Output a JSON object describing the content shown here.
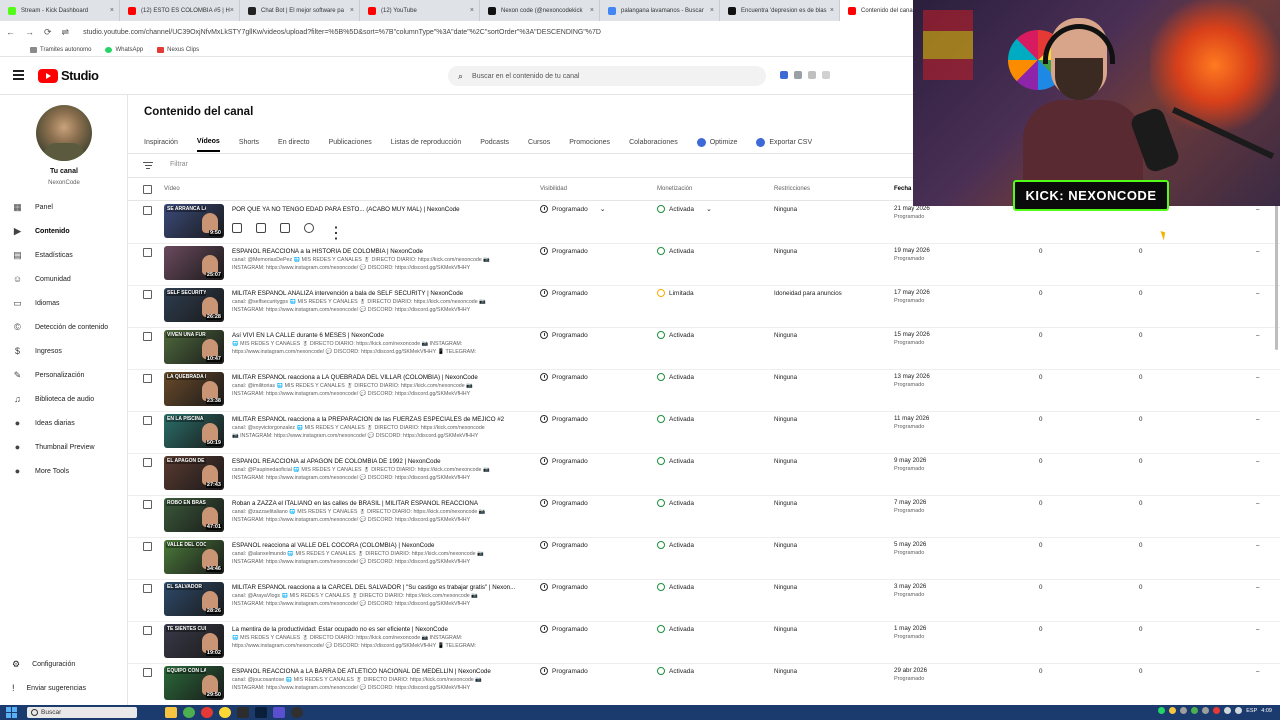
{
  "browser": {
    "tabs": [
      {
        "label": "Stream - Kick Dashboard",
        "color": "#53fc18",
        "active": false
      },
      {
        "label": "(12) ESTO ES COLOMBIA #5 | H",
        "color": "#ff0000",
        "active": false
      },
      {
        "label": "Chat Bot | El mejor software pa",
        "color": "#222222",
        "active": false
      },
      {
        "label": "(12) YouTube",
        "color": "#ff0000",
        "active": false
      },
      {
        "label": "Nexon code (@nexoncodekick",
        "color": "#111111",
        "active": false
      },
      {
        "label": "palangana lavamanos - Buscar",
        "color": "#4285f4",
        "active": false
      },
      {
        "label": "Encuentra 'depresion es de blas",
        "color": "#111111",
        "active": false
      },
      {
        "label": "Contenido del canal",
        "color": "#ff0000",
        "active": true
      }
    ],
    "url": "studio.youtube.com/channel/UC39OxjNfvMxLkSTY7gllKw/videos/upload?filter=%5B%5D&sort=%7B\"columnType\"%3A\"date\"%2C\"sortOrder\"%3A\"DESCENDING\"%7D",
    "bookmarks": [
      "Tramites autonomo",
      "WhatsApp",
      "Nexus Clips"
    ]
  },
  "header": {
    "logo_text": "Studio",
    "search_placeholder": "Buscar en el contenido de tu canal"
  },
  "sidebar": {
    "channel_name": "Tu canal",
    "channel_handle": "NexonCode",
    "items": [
      {
        "label": "Panel",
        "icon": "dashboard-icon",
        "active": false
      },
      {
        "label": "Contenido",
        "icon": "content-icon",
        "active": true
      },
      {
        "label": "Estadísticas",
        "icon": "analytics-icon",
        "active": false
      },
      {
        "label": "Comunidad",
        "icon": "community-icon",
        "active": false
      },
      {
        "label": "Idiomas",
        "icon": "subtitles-icon",
        "active": false
      },
      {
        "label": "Detección de contenido",
        "icon": "copyright-icon",
        "active": false
      },
      {
        "label": "Ingresos",
        "icon": "dollar-icon",
        "active": false
      },
      {
        "label": "Personalización",
        "icon": "wand-icon",
        "active": false
      },
      {
        "label": "Biblioteca de audio",
        "icon": "audio-library-icon",
        "active": false
      },
      {
        "label": "Ideas diarias",
        "icon": "ideas-icon",
        "active": false
      },
      {
        "label": "Thumbnail Preview",
        "icon": "thumbnail-preview-icon",
        "active": false
      },
      {
        "label": "More Tools",
        "icon": "tools-icon",
        "active": false
      }
    ],
    "footer": [
      {
        "label": "Configuración",
        "icon": "gear-icon"
      },
      {
        "label": "Enviar sugerencias",
        "icon": "feedback-icon"
      }
    ]
  },
  "main": {
    "title": "Contenido del canal",
    "tabs": [
      "Inspiración",
      "Vídeos",
      "Shorts",
      "En directo",
      "Publicaciones",
      "Listas de reproducción",
      "Podcasts",
      "Cursos",
      "Promociones",
      "Colaboraciones",
      "Optimize",
      "Exportar CSV"
    ],
    "active_tab": "Vídeos",
    "filter_placeholder": "Filtrar",
    "columns": {
      "video": "Vídeo",
      "visibility": "Visibilidad",
      "monetization": "Monetización",
      "restrictions": "Restricciones",
      "date": "Fecha"
    }
  },
  "videos": [
    {
      "title": "POR QUÉ YA NO TENGO EDAD PARA ESTO... (ACABÓ MUY MAL) | NexonCode",
      "desc1": "",
      "desc2": "",
      "duration": "9:50",
      "thumb_text": "SE ARRANCA LA NARIZ",
      "thumb_color": "#3b4a7a",
      "visibility": "Programado",
      "monetization": "Activada",
      "restrictions": "Ninguna",
      "date": "21 may 2026",
      "status": "Programado",
      "v1": "0",
      "v2": "0",
      "v3": "–"
    },
    {
      "title": "ESPAÑOL REACCIONA a la HISTORIA DE COLOMBIA | NexonCode",
      "desc1": "canal: @MemoriasDePez 🌐 MIS REDES Y CANALES 🎖 DIRECTO DIARIO: https://kick.com/nexoncode 📷",
      "desc2": "INSTAGRAM: https://www.instagram.com/nexoncode/ 💬 DISCORD: https://discord.gg/SKMekVfHHY",
      "duration": "25:07",
      "thumb_text": "",
      "thumb_color": "#6b4a5e",
      "visibility": "Programado",
      "monetization": "Activada",
      "restrictions": "Ninguna",
      "date": "19 may 2026",
      "status": "Programado",
      "v1": "0",
      "v2": "0",
      "v3": "–"
    },
    {
      "title": "MILITAR ESPAÑOL ANALIZA intervención a bala de SELF SECURITY | NexonCode",
      "desc1": "canal: @selfsecuritygps 🌐 MIS REDES Y CANALES 🎖 DIRECTO DIARIO: https://kick.com/nexoncode 📷",
      "desc2": "INSTAGRAM: https://www.instagram.com/nexoncode/ 💬 DISCORD: https://discord.gg/SKMekVfHHY",
      "duration": "26:28",
      "thumb_text": "SELF SECURITY COLOMBIA",
      "thumb_color": "#2e3d50",
      "visibility": "Programado",
      "monetization": "Limitada",
      "restrictions": "Idoneidad para anuncios",
      "date": "17 may 2026",
      "status": "Programado",
      "v1": "0",
      "v2": "0",
      "v3": "–"
    },
    {
      "title": "Así VIVÍ EN LA CALLE durante 6 MESES | NexonCode",
      "desc1": "🌐 MIS REDES Y CANALES 🎖 DIRECTO DIARIO: https://kick.com/nexoncode 📷 INSTAGRAM:",
      "desc2": "https://www.instagram.com/nexoncode/ 💬 DISCORD: https://discord.gg/SKMekVfHHY 📱 TELEGRAM:",
      "duration": "10:47",
      "thumb_text": "VIVEN UNA FURGONETA",
      "thumb_color": "#4e6a3c",
      "visibility": "Programado",
      "monetization": "Activada",
      "restrictions": "Ninguna",
      "date": "15 may 2026",
      "status": "Programado",
      "v1": "0",
      "v2": "0",
      "v3": "–"
    },
    {
      "title": "MILITAR ESPAÑOL reacciona a LA QUEBRADA DEL VILLAR (COLOMBIA) | NexonCode",
      "desc1": "canal: @imilitorias 🌐 MIS REDES Y CANALES 🎖 DIRECTO DIARIO: https://kick.com/nexoncode 📷",
      "desc2": "INSTAGRAM: https://www.instagram.com/nexoncode/ 💬 DISCORD: https://discord.gg/SKMekVfHHY",
      "duration": "23:38",
      "thumb_text": "LA QUEBRADA DEL VILLAR",
      "thumb_color": "#6a4a2a",
      "visibility": "Programado",
      "monetization": "Activada",
      "restrictions": "Ninguna",
      "date": "13 may 2026",
      "status": "Programado",
      "v1": "0",
      "v2": "0",
      "v3": "–"
    },
    {
      "title": "MILITAR ESPAÑOL reacciona a la PREPARACIÓN de las FUERZAS ESPECIALES de MÉJICO #2",
      "desc1": "canal: @soyvictorgonzalez 🌐 MIS REDES Y CANALES 🎖 DIRECTO DIARIO: https://kick.com/nexoncode",
      "desc2": "📷 INSTAGRAM: https://www.instagram.com/nexoncode/ 💬 DISCORD: https://discord.gg/SKMekVfHHY",
      "duration": "50:19",
      "thumb_text": "EN LA PISCINA",
      "thumb_color": "#2a6f6a",
      "visibility": "Programado",
      "monetization": "Activada",
      "restrictions": "Ninguna",
      "date": "11 may 2026",
      "status": "Programado",
      "v1": "0",
      "v2": "0",
      "v3": "–"
    },
    {
      "title": "ESPAÑOL REACCIONA al APAGON DE COLOMBIA DE 1992 | NexonCode",
      "desc1": "canal: @Paupinedaoficial 🌐 MIS REDES Y CANALES 🎖 DIRECTO DIARIO: https://kick.com/nexoncode 📷",
      "desc2": "INSTAGRAM: https://www.instagram.com/nexoncode/ 💬 DISCORD: https://discord.gg/SKMekVfHHY",
      "duration": "27:43",
      "thumb_text": "EL APAGÓN DE COLOMBIA",
      "thumb_color": "#5a3a30",
      "visibility": "Programado",
      "monetization": "Activada",
      "restrictions": "Ninguna",
      "date": "9 may 2026",
      "status": "Programado",
      "v1": "0",
      "v2": "0",
      "v3": "–"
    },
    {
      "title": "Roban a ZAZZA el ITALIANO en las calles de BRASIL | MILITAR ESPAÑOL REACCIONA",
      "desc1": "canal: @zazzaelitaliano 🌐 MIS REDES Y CANALES 🎖 DIRECTO DIARIO: https://kick.com/nexoncode 📷",
      "desc2": "INSTAGRAM: https://www.instagram.com/nexoncode/ 💬 DISCORD: https://discord.gg/SKMekVfHHY",
      "duration": "47:01",
      "thumb_text": "ROBO EN BRASIL",
      "thumb_color": "#3a5a3a",
      "visibility": "Programado",
      "monetization": "Activada",
      "restrictions": "Ninguna",
      "date": "7 may 2026",
      "status": "Programado",
      "v1": "0",
      "v2": "0",
      "v3": "–"
    },
    {
      "title": "ESPAÑOL reacciona al VALLE DEL COCORA (COLOMBIA) | NexonCode",
      "desc1": "canal: @alanxelmundo 🌐 MIS REDES Y CANALES 🎖 DIRECTO DIARIO: https://kick.com/nexoncode 📷",
      "desc2": "INSTAGRAM: https://www.instagram.com/nexoncode/ 💬 DISCORD: https://discord.gg/SKMekVfHHY",
      "duration": "34:46",
      "thumb_text": "VALLE DEL COCORA",
      "thumb_color": "#4a7a3a",
      "visibility": "Programado",
      "monetization": "Activada",
      "restrictions": "Ninguna",
      "date": "5 may 2026",
      "status": "Programado",
      "v1": "0",
      "v2": "0",
      "v3": "–"
    },
    {
      "title": "MILITAR ESPAÑOL reacciona a la CARCEL DEL SALVADOR | \"Su castigo es trabajar gratis\" | Nexon...",
      "desc1": "canal: @ArayaVlogs 🌐 MIS REDES Y CANALES 🎖 DIRECTO DIARIO: https://kick.com/nexoncode 📷",
      "desc2": "INSTAGRAM: https://www.instagram.com/nexoncode/ 💬 DISCORD: https://discord.gg/SKMekVfHHY",
      "duration": "28:26",
      "thumb_text": "EL SALVADOR",
      "thumb_color": "#2d4a6a",
      "visibility": "Programado",
      "monetization": "Activada",
      "restrictions": "Ninguna",
      "date": "3 may 2026",
      "status": "Programado",
      "v1": "0",
      "v2": "0",
      "v3": "–"
    },
    {
      "title": "La mentira de la productividad: Estar ocupado no es ser eficiente | NexonCode",
      "desc1": "🌐 MIS REDES Y CANALES 🎖 DIRECTO DIARIO: https://kick.com/nexoncode 📷 INSTAGRAM:",
      "desc2": "https://www.instagram.com/nexoncode/ 💬 DISCORD: https://discord.gg/SKMekVfHHY 📱 TELEGRAM:",
      "duration": "19:02",
      "thumb_text": "TE SIENTES CULPABLE AL DESCANSAR",
      "thumb_color": "#3a3a4a",
      "visibility": "Programado",
      "monetization": "Activada",
      "restrictions": "Ninguna",
      "date": "1 may 2026",
      "status": "Programado",
      "v1": "0",
      "v2": "0",
      "v3": "–"
    },
    {
      "title": "ESPAÑOL REACCIONA a LA BARRA DE ATLÉTICO NACIONAL DE MEDELLÍN | NexonCode",
      "desc1": "canal: @joucosantose 🌐 MIS REDES Y CANALES 🎖 DIRECTO DIARIO: https://kick.com/nexoncode 📷",
      "desc2": "INSTAGRAM: https://www.instagram.com/nexoncode/ 💬 DISCORD: https://discord.gg/SKMekVfHHY",
      "duration": "29:50",
      "thumb_text": "EQUIPO CON LA BARRA",
      "thumb_color": "#2a6a3a",
      "visibility": "Programado",
      "monetization": "Activada",
      "restrictions": "Ninguna",
      "date": "29 abr 2026",
      "status": "Programado",
      "v1": "0",
      "v2": "0",
      "v3": "–"
    }
  ],
  "overlay": {
    "kick_label": "KICK: NEXONCODE"
  },
  "taskbar": {
    "search_label": "Buscar",
    "language": "ESP",
    "time": "4:09"
  }
}
